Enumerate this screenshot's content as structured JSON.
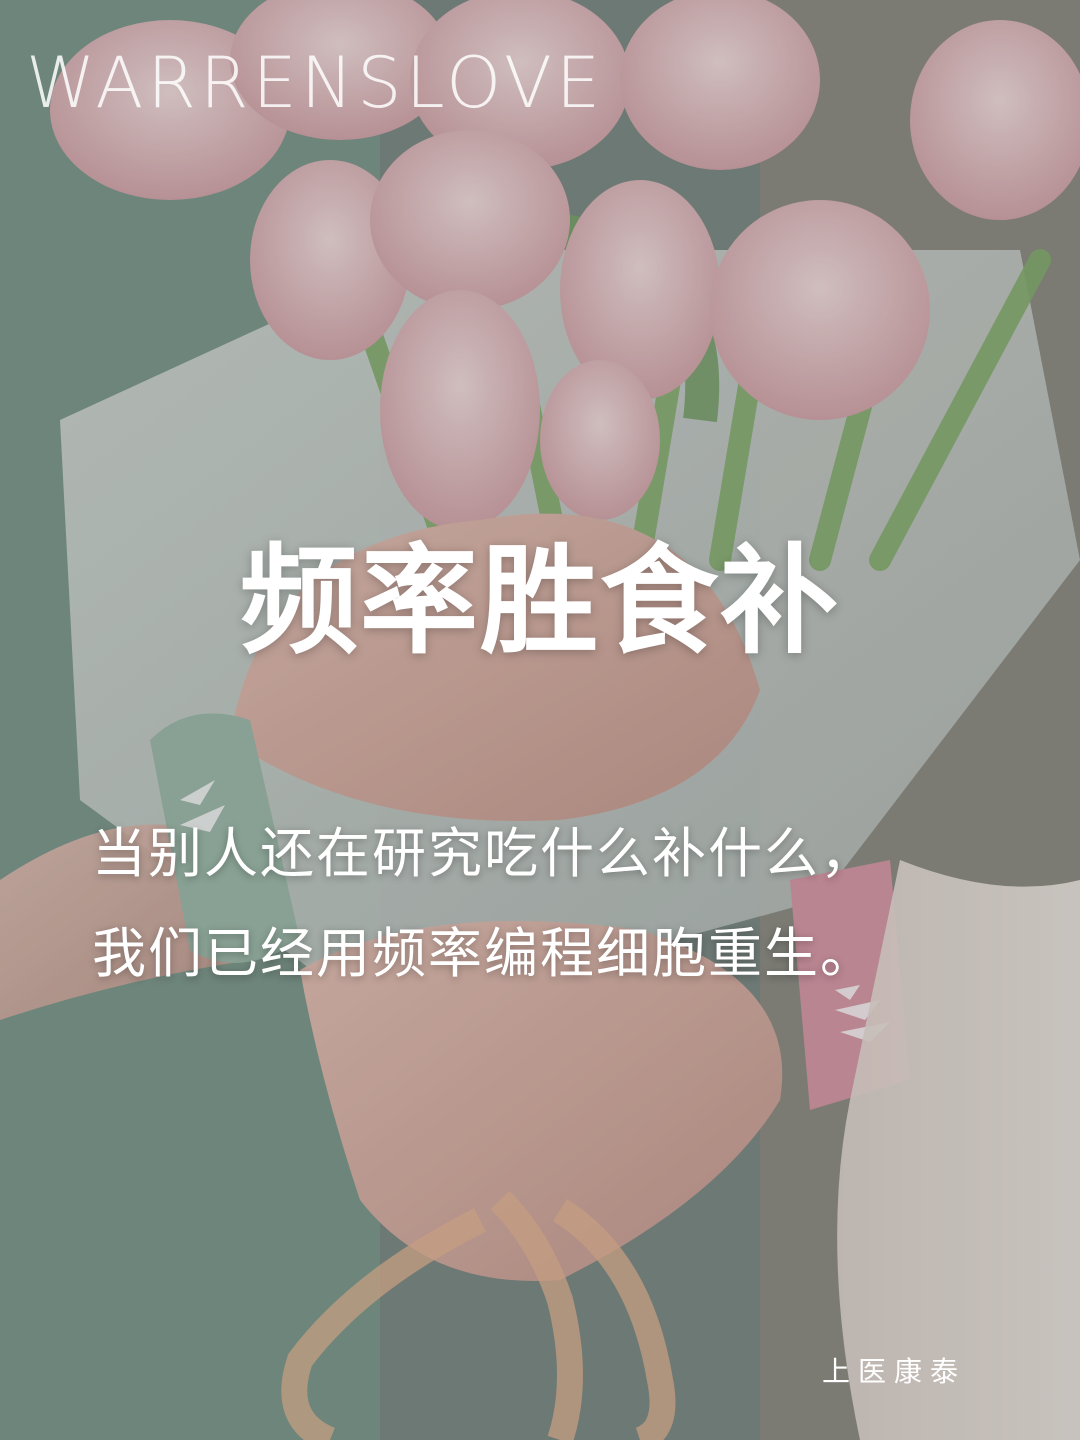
{
  "brand": "WARRENSLOVE",
  "headline": "频率胜食补",
  "subtitle_lines": [
    "当别人还在研究吃什么补什么，",
    "我们已经用频率编程细胞重生。"
  ],
  "signature": "上医康泰",
  "colors": {
    "text": "#ffffff",
    "tulip_pink": "#e9c4c6",
    "leaf_green": "#7aa36a",
    "green_band": "#9fbcac",
    "pink_band": "#d99aa9"
  }
}
